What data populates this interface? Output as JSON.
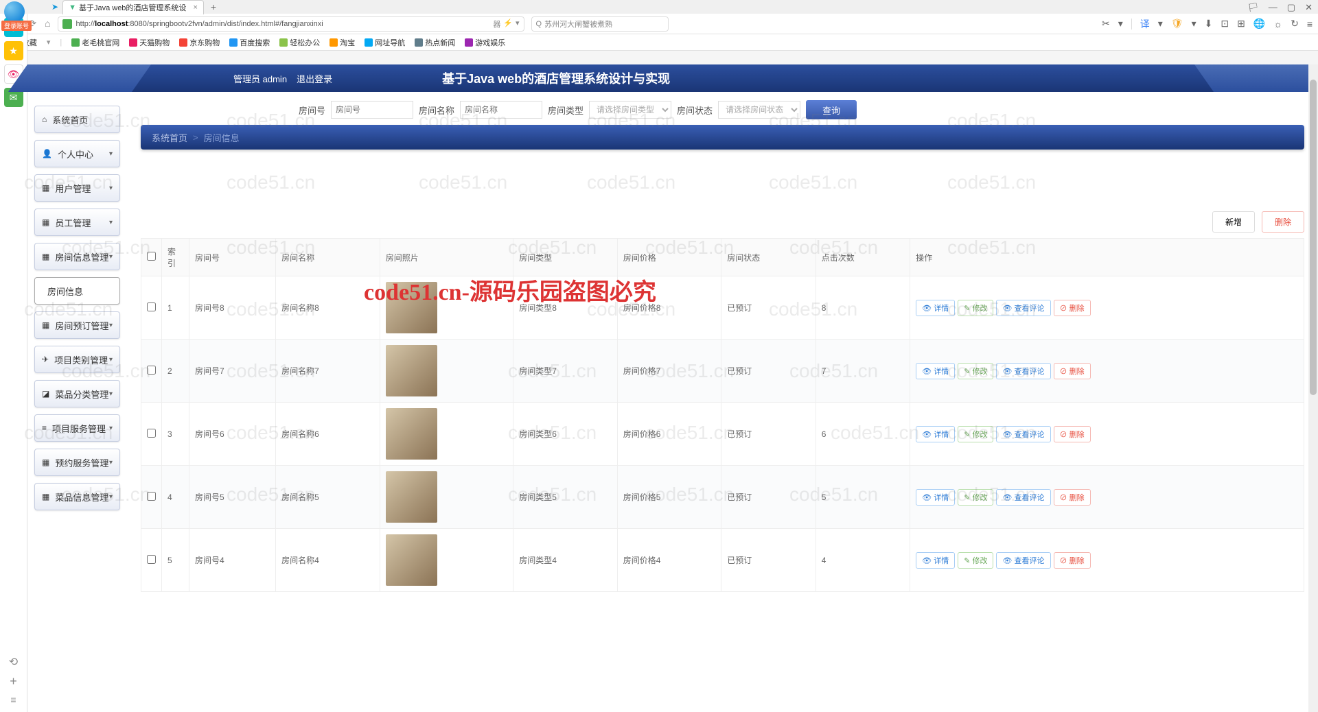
{
  "browser": {
    "tab_title": "基于Java web的酒店管理系统设",
    "url_pre": "http://",
    "url_host": "localhost",
    "url_rest": ":8080/springbootv2fvn/admin/dist/index.html#/fangjianxinxi",
    "search_placeholder": "苏州河大闸蟹被煮熟",
    "login_badge": "登录账号"
  },
  "bookmarks": [
    "老毛桃官网",
    "天猫购物",
    "京东购物",
    "百度搜索",
    "轻松办公",
    "淘宝",
    "网址导航",
    "热点新闻",
    "游戏娱乐"
  ],
  "bookmark_label": "收藏",
  "header": {
    "role": "管理员",
    "username": "admin",
    "logout": "退出登录",
    "title": "基于Java web的酒店管理系统设计与实现"
  },
  "sidenav": [
    {
      "icon": "⌂",
      "label": "系统首页",
      "expand": false
    },
    {
      "icon": "👤",
      "label": "个人中心",
      "expand": true
    },
    {
      "icon": "▦",
      "label": "用户管理",
      "expand": true
    },
    {
      "icon": "▦",
      "label": "员工管理",
      "expand": true
    },
    {
      "icon": "▦",
      "label": "房间信息管理",
      "expand": true
    },
    {
      "icon": "",
      "label": "房间信息",
      "expand": false,
      "active": true
    },
    {
      "icon": "▦",
      "label": "房间预订管理",
      "expand": true
    },
    {
      "icon": "✈",
      "label": "项目类别管理",
      "expand": true
    },
    {
      "icon": "◪",
      "label": "菜品分类管理",
      "expand": true
    },
    {
      "icon": "≡",
      "label": "项目服务管理",
      "expand": true
    },
    {
      "icon": "▦",
      "label": "预约服务管理",
      "expand": true
    },
    {
      "icon": "▦",
      "label": "菜品信息管理",
      "expand": true
    }
  ],
  "search": {
    "roomno_label": "房间号",
    "roomno_ph": "房间号",
    "roomname_label": "房间名称",
    "roomname_ph": "房间名称",
    "roomtype_label": "房间类型",
    "roomtype_ph": "请选择房间类型",
    "roomstatus_label": "房间状态",
    "roomstatus_ph": "请选择房间状态",
    "query_btn": "查询"
  },
  "breadcrumb": {
    "home": "系统首页",
    "sep": ">",
    "current": "房间信息"
  },
  "actions": {
    "add": "新增",
    "del": "删除"
  },
  "table": {
    "headers": [
      "索引",
      "房间号",
      "房间名称",
      "房间照片",
      "房间类型",
      "房间价格",
      "房间状态",
      "点击次数",
      "操作"
    ],
    "ops": {
      "view": "详情",
      "edit": "修改",
      "comment": "查看评论",
      "del": "删除"
    },
    "rows": [
      {
        "idx": "1",
        "no": "房间号8",
        "name": "房间名称8",
        "type": "房间类型8",
        "price": "房间价格8",
        "status": "已预订",
        "clicks": "8"
      },
      {
        "idx": "2",
        "no": "房间号7",
        "name": "房间名称7",
        "type": "房间类型7",
        "price": "房间价格7",
        "status": "已预订",
        "clicks": "7"
      },
      {
        "idx": "3",
        "no": "房间号6",
        "name": "房间名称6",
        "type": "房间类型6",
        "price": "房间价格6",
        "status": "已预订",
        "clicks": "6"
      },
      {
        "idx": "4",
        "no": "房间号5",
        "name": "房间名称5",
        "type": "房间类型5",
        "price": "房间价格5",
        "status": "已预订",
        "clicks": "5"
      },
      {
        "idx": "5",
        "no": "房间号4",
        "name": "房间名称4",
        "type": "房间类型4",
        "price": "房间价格4",
        "status": "已预订",
        "clicks": "4"
      }
    ]
  },
  "watermark_text": "code51.cn",
  "watermark_red": "code51.cn-源码乐园盗图必究"
}
